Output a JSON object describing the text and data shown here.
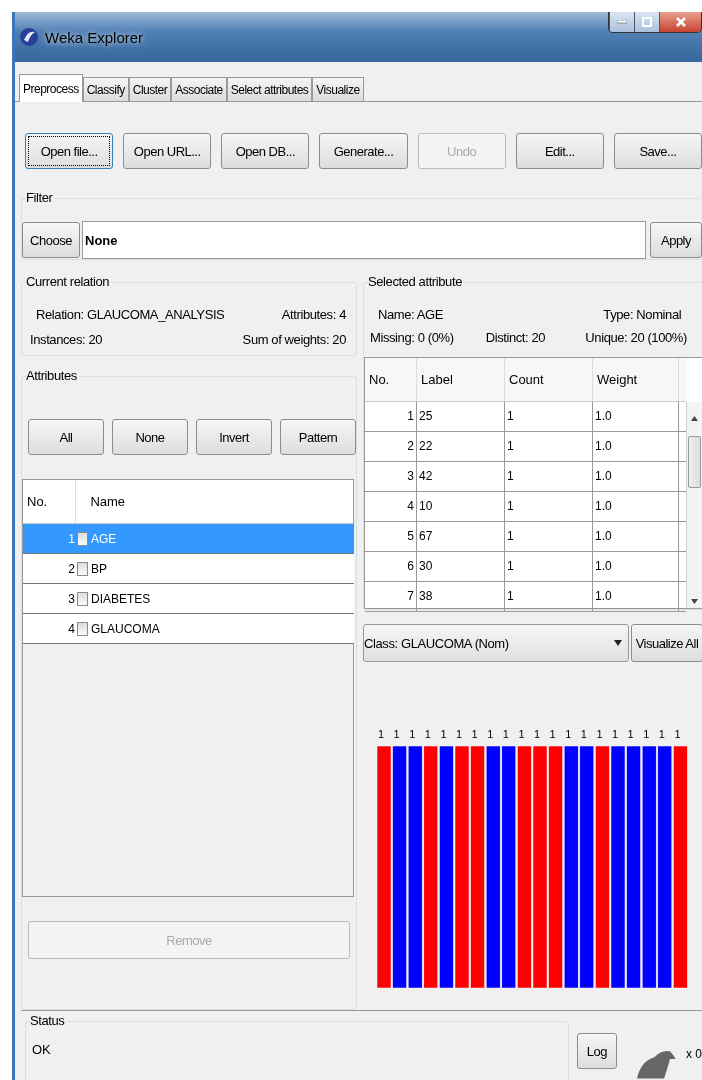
{
  "window": {
    "title": "Weka Explorer"
  },
  "tabs": [
    {
      "label": "Preprocess",
      "selected": true
    },
    {
      "label": "Classify",
      "selected": false
    },
    {
      "label": "Cluster",
      "selected": false
    },
    {
      "label": "Associate",
      "selected": false
    },
    {
      "label": "Select attributes",
      "selected": false
    },
    {
      "label": "Visualize",
      "selected": false
    }
  ],
  "toolbar": [
    {
      "label": "Open file...",
      "disabled": false,
      "focused": true
    },
    {
      "label": "Open URL...",
      "disabled": false,
      "focused": false
    },
    {
      "label": "Open DB...",
      "disabled": false,
      "focused": false
    },
    {
      "label": "Generate...",
      "disabled": false,
      "focused": false
    },
    {
      "label": "Undo",
      "disabled": true,
      "focused": false
    },
    {
      "label": "Edit...",
      "disabled": false,
      "focused": false
    },
    {
      "label": "Save...",
      "disabled": false,
      "focused": false
    }
  ],
  "filter": {
    "title": "Filter",
    "choose": "Choose",
    "value": "None",
    "apply": "Apply"
  },
  "current_relation": {
    "title": "Current relation",
    "relation_label": "Relation:",
    "relation": "GLAUCOMA_ANALYSIS",
    "attributes_label": "Attributes:",
    "attributes": "4",
    "instances_label": "Instances:",
    "instances": "20",
    "sum_label": "Sum of weights:",
    "sum": "20"
  },
  "attributes": {
    "title": "Attributes",
    "buttons": [
      "All",
      "None",
      "Invert",
      "Pattern"
    ],
    "columns": [
      "No.",
      "Name"
    ],
    "rows": [
      {
        "no": "1",
        "name": "AGE",
        "selected": true,
        "checked": false
      },
      {
        "no": "2",
        "name": "BP",
        "selected": false,
        "checked": false
      },
      {
        "no": "3",
        "name": "DIABETES",
        "selected": false,
        "checked": false
      },
      {
        "no": "4",
        "name": "GLAUCOMA",
        "selected": false,
        "checked": false
      }
    ],
    "remove": {
      "label": "Remove",
      "disabled": true
    }
  },
  "selected_attribute": {
    "title": "Selected attribute",
    "name_label": "Name:",
    "name": "AGE",
    "type_label": "Type:",
    "type": "Nominal",
    "missing_label": "Missing:",
    "missing": "0 (0%)",
    "distinct_label": "Distinct:",
    "distinct": "20",
    "unique_label": "Unique:",
    "unique": "20 (100%)",
    "columns": [
      "No.",
      "Label",
      "Count",
      "Weight"
    ],
    "rows": [
      [
        "1",
        "25",
        "1",
        "1.0"
      ],
      [
        "2",
        "22",
        "1",
        "1.0"
      ],
      [
        "3",
        "42",
        "1",
        "1.0"
      ],
      [
        "4",
        "10",
        "1",
        "1.0"
      ],
      [
        "5",
        "67",
        "1",
        "1.0"
      ],
      [
        "6",
        "30",
        "1",
        "1.0"
      ],
      [
        "7",
        "38",
        "1",
        "1.0"
      ]
    ]
  },
  "class_select": {
    "value": "Class: GLAUCOMA (Nom)",
    "visualize": "Visualize All"
  },
  "histogram": [
    {
      "count": "1",
      "color": "#ff0000"
    },
    {
      "count": "1",
      "color": "#0000ff"
    },
    {
      "count": "1",
      "color": "#0000ff"
    },
    {
      "count": "1",
      "color": "#ff0000"
    },
    {
      "count": "1",
      "color": "#0000ff"
    },
    {
      "count": "1",
      "color": "#ff0000"
    },
    {
      "count": "1",
      "color": "#ff0000"
    },
    {
      "count": "1",
      "color": "#0000ff"
    },
    {
      "count": "1",
      "color": "#0000ff"
    },
    {
      "count": "1",
      "color": "#ff0000"
    },
    {
      "count": "1",
      "color": "#ff0000"
    },
    {
      "count": "1",
      "color": "#ff0000"
    },
    {
      "count": "1",
      "color": "#0000ff"
    },
    {
      "count": "1",
      "color": "#0000ff"
    },
    {
      "count": "1",
      "color": "#ff0000"
    },
    {
      "count": "1",
      "color": "#0000ff"
    },
    {
      "count": "1",
      "color": "#0000ff"
    },
    {
      "count": "1",
      "color": "#0000ff"
    },
    {
      "count": "1",
      "color": "#0000ff"
    },
    {
      "count": "1",
      "color": "#ff0000"
    }
  ],
  "status": {
    "title": "Status",
    "message": "OK",
    "log": "Log",
    "tasks": "x 0"
  }
}
